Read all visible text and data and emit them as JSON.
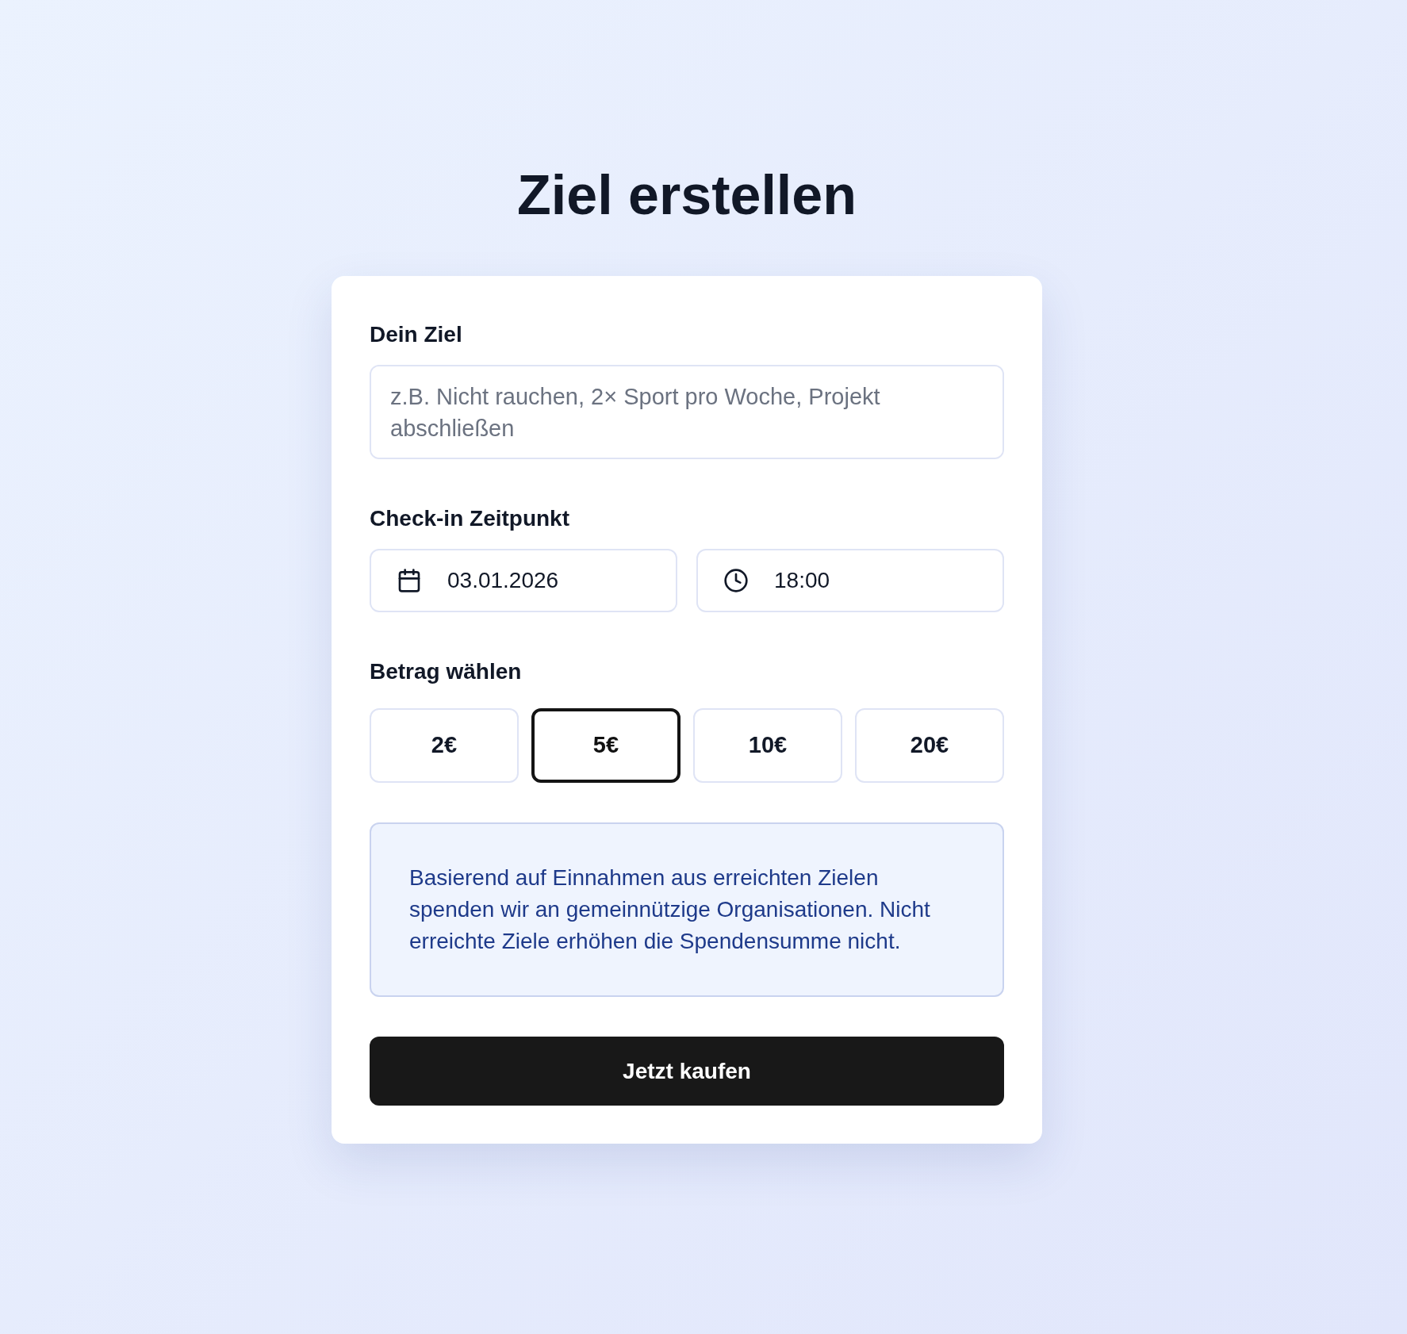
{
  "title": "Ziel erstellen",
  "goal": {
    "label": "Dein Ziel",
    "placeholder": "z.B. Nicht rauchen, 2× Sport pro Woche, Projekt abschließen"
  },
  "checkin": {
    "label": "Check-in Zeitpunkt",
    "fields": [
      {
        "kind": "date",
        "value": "03.01.2026"
      },
      {
        "kind": "time",
        "value": "18:00"
      }
    ]
  },
  "amount": {
    "label": "Betrag wählen",
    "options": [
      {
        "label": "2€",
        "selected": false
      },
      {
        "label": "5€",
        "selected": true
      },
      {
        "label": "10€",
        "selected": false
      },
      {
        "label": "20€",
        "selected": false
      }
    ]
  },
  "info": "Basierend auf Einnahmen aus erreichten Zielen spenden wir an gemeinnützige Organisationen. Nicht erreichte Ziele erhöhen die Spendensumme nicht.",
  "submit": "Jetzt kaufen"
}
